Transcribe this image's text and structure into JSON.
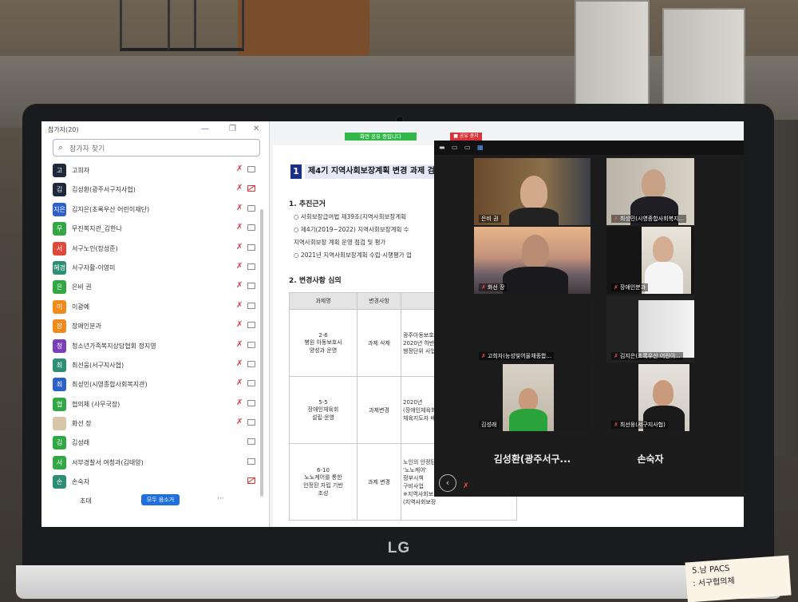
{
  "participants": {
    "title": "참가자(20)",
    "search_placeholder": "참가자 찾기",
    "items": [
      {
        "initial": "고",
        "name": "고희자",
        "color": "#1e2a3c",
        "mic_muted": true,
        "cam_off": false
      },
      {
        "initial": "김",
        "name": "김성환(광주서구지사협)",
        "color": "#1e2a3c",
        "mic_muted": true,
        "cam_off": true
      },
      {
        "initial": "지은",
        "name": "김지은(초록우산 어린이재단)",
        "color": "#2b61c8",
        "mic_muted": true,
        "cam_off": false
      },
      {
        "initial": "무",
        "name": "무진복지관_김한나",
        "color": "#31a843",
        "mic_muted": true,
        "cam_off": false
      },
      {
        "initial": "서",
        "name": "서구노인(장성준)",
        "color": "#e0483a",
        "mic_muted": true,
        "cam_off": false
      },
      {
        "initial": "혜경",
        "name": "서구자활-이영미",
        "color": "#2c8f75",
        "mic_muted": true,
        "cam_off": false
      },
      {
        "initial": "은",
        "name": "은비 권",
        "color": "#31a843",
        "mic_muted": true,
        "cam_off": false
      },
      {
        "initial": "이",
        "name": "이광예",
        "color": "#f08a1a",
        "mic_muted": true,
        "cam_off": false
      },
      {
        "initial": "장",
        "name": "장애인분과",
        "color": "#f08a1a",
        "mic_muted": true,
        "cam_off": false
      },
      {
        "initial": "청",
        "name": "청소년가족복지상담협회 정지영",
        "color": "#7a3fb8",
        "mic_muted": true,
        "cam_off": false
      },
      {
        "initial": "최",
        "name": "최선웅(서구지사협)",
        "color": "#2c8f75",
        "mic_muted": true,
        "cam_off": false
      },
      {
        "initial": "최",
        "name": "최성민(시영종합사회복지관)",
        "color": "#2b61c8",
        "mic_muted": true,
        "cam_off": false
      },
      {
        "initial": "협",
        "name": "협의체 (사무국장)",
        "color": "#31a843",
        "mic_muted": true,
        "cam_off": false
      },
      {
        "initial": "",
        "name": "화선 장",
        "color": "#d7c7a8",
        "mic_muted": true,
        "cam_off": false
      },
      {
        "initial": "김",
        "name": "김성래",
        "color": "#31a843",
        "mic_muted": false,
        "cam_off": false
      },
      {
        "initial": "서",
        "name": "서부경찰서 여청과(김태양)",
        "color": "#31a843",
        "mic_muted": false,
        "cam_off": false
      },
      {
        "initial": "손",
        "name": "손숙자",
        "color": "#2c8f75",
        "mic_muted": false,
        "cam_off": true
      }
    ],
    "invite_label": "초대",
    "mute_all_label": "모두 음소거",
    "more_label": "···"
  },
  "share": {
    "status_label": "화면 공유 중입니다",
    "stop_label": "■ 공유 중지"
  },
  "document": {
    "section_number": "1",
    "section_title": "제4기 지역사회보장계획 변경 과제 검토",
    "heading1": "1. 추진근거",
    "lines1": [
      "○ 사회보장급여법 제39조(지역사회보장계획",
      "○ 제4기(2019~2022) 지역사회보장계획 수",
      "지역사회보장 계획 운영 점검 및 평가",
      "○ 2021년 지역사회보장계획 수립·시행평가 업"
    ],
    "heading2": "2. 변경사항 심의",
    "table": {
      "headers": [
        "과제명",
        "변경사항",
        ""
      ],
      "rows": [
        {
          "task": [
            "2-6",
            "병원 아동보호사",
            "양성과 운영"
          ],
          "change": "과제 삭제",
          "note": [
            "광주아동보호",
            "2020년 하반기",
            "행정단위 사업"
          ]
        },
        {
          "task": [
            "5-5",
            "장애인체육회",
            "설립·운영"
          ],
          "change": "과제변경",
          "note": [
            "2020년",
            "(장애인체육회",
            "체육지도자 배"
          ]
        },
        {
          "task": [
            "6-10",
            "노노케어를 통한",
            "안정된 자립 기반",
            "조성"
          ],
          "change": "과제 변경",
          "note": [
            "노인의 안정된",
            "'노노케어'",
            "정부시책",
            "구비사업",
            "",
            "※지역사회보",
            "(지역사회보장"
          ]
        }
      ]
    }
  },
  "gallery": {
    "tiles": [
      {
        "label": "은비 권",
        "muted": false
      },
      {
        "label": "최성민(시영종합사회복지...",
        "muted": true
      },
      {
        "label": "화선 장",
        "muted": true
      },
      {
        "label": "장애인분과",
        "muted": true
      },
      {
        "label": "고희자(능성빛어울채종합...",
        "muted": true
      },
      {
        "label": "김지은(초록우산 어린이...",
        "muted": true
      },
      {
        "label": "김성래",
        "muted": false
      },
      {
        "label": "최선웅(서구지사협)",
        "muted": true
      }
    ],
    "name_only_tiles": [
      "김성환(광주서구...",
      "손숙자"
    ],
    "back_icon": "chevron-left-icon"
  },
  "laptop": {
    "brand": "LG",
    "sticky_note_lines": [
      "5.남 PACS",
      ": 서구협의체"
    ]
  }
}
